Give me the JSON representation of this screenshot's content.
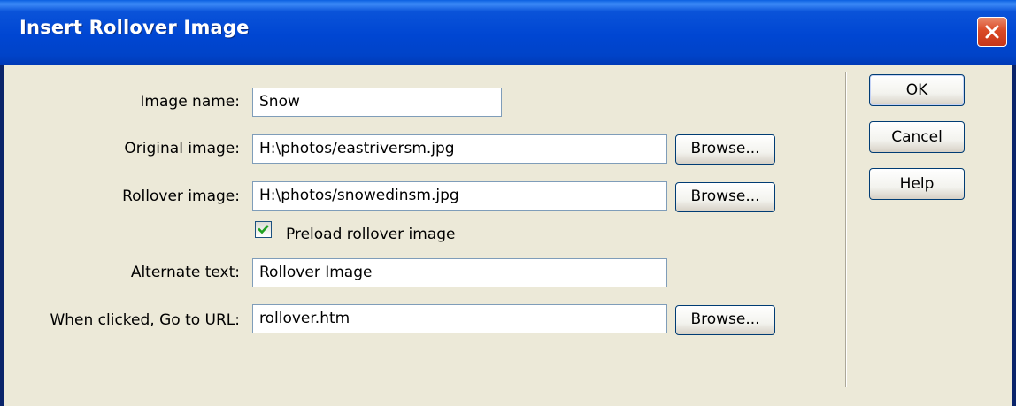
{
  "window": {
    "title": "Insert Rollover Image"
  },
  "form": {
    "image_name": {
      "label": "Image name:",
      "value": "Snow"
    },
    "original_image": {
      "label": "Original image:",
      "value": "H:\\photos/eastriversm.jpg",
      "browse": "Browse..."
    },
    "rollover_image": {
      "label": "Rollover image:",
      "value": "H:\\photos/snowedinsm.jpg",
      "browse": "Browse..."
    },
    "preload": {
      "label": "Preload rollover image",
      "checked": true
    },
    "alternate_text": {
      "label": "Alternate text:",
      "value": "Rollover Image"
    },
    "url": {
      "label": "When clicked, Go to URL:",
      "value": "rollover.htm",
      "browse": "Browse..."
    }
  },
  "buttons": {
    "ok": "OK",
    "cancel": "Cancel",
    "help": "Help"
  },
  "icons": {
    "close": "close-icon",
    "check": "checkmark-icon"
  },
  "colors": {
    "titlebar": "#0046D2",
    "face": "#ECE9D8",
    "close": "#DA4A26",
    "check": "#21A121"
  }
}
